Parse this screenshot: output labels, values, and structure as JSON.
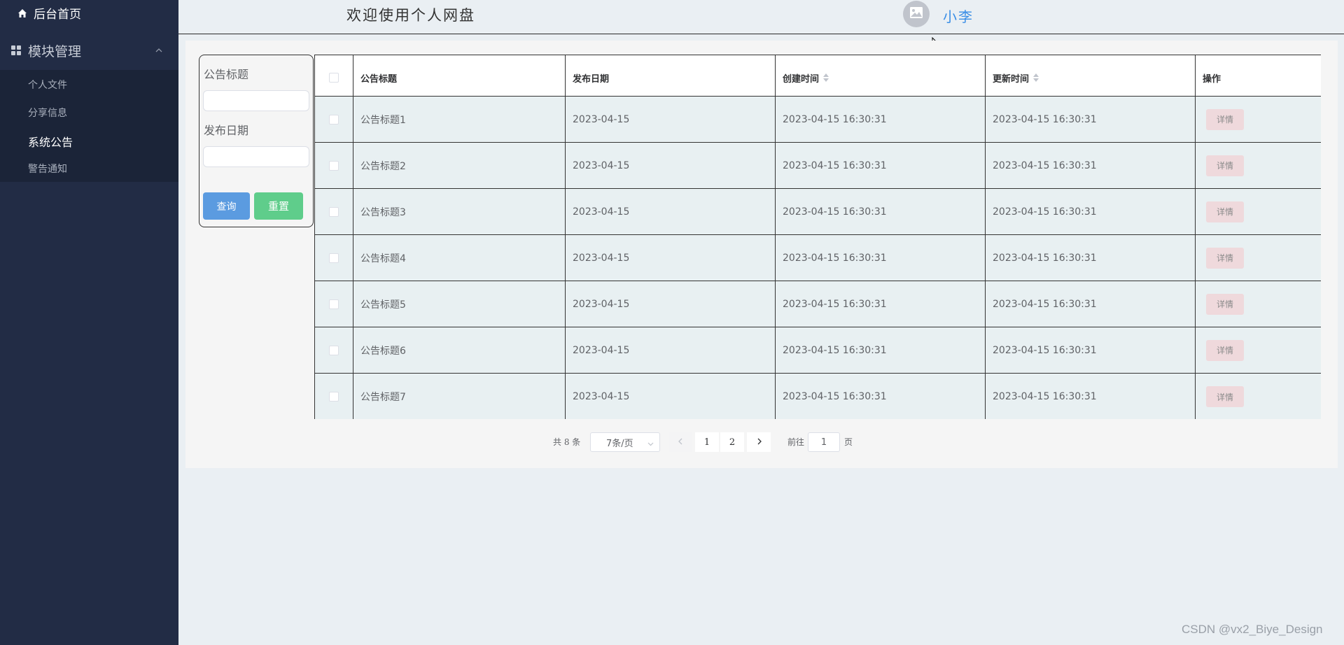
{
  "sidebar": {
    "home_label": "后台首页",
    "group_label": "模块管理",
    "items": [
      {
        "label": "个人文件"
      },
      {
        "label": "分享信息"
      },
      {
        "label": "系统公告",
        "active": true
      },
      {
        "label": "警告通知"
      }
    ]
  },
  "header": {
    "title": "欢迎使用个人网盘",
    "username": "小李"
  },
  "search": {
    "title_label": "公告标题",
    "date_label": "发布日期",
    "query_button": "查询",
    "reset_button": "重置"
  },
  "table": {
    "columns": [
      "公告标题",
      "发布日期",
      "创建时间",
      "更新时间",
      "操作"
    ],
    "rows": [
      {
        "title": "公告标题1",
        "publish_date": "2023-04-15",
        "created": "2023-04-15 16:30:31",
        "updated": "2023-04-15 16:30:31",
        "action": "详情"
      },
      {
        "title": "公告标题2",
        "publish_date": "2023-04-15",
        "created": "2023-04-15 16:30:31",
        "updated": "2023-04-15 16:30:31",
        "action": "详情"
      },
      {
        "title": "公告标题3",
        "publish_date": "2023-04-15",
        "created": "2023-04-15 16:30:31",
        "updated": "2023-04-15 16:30:31",
        "action": "详情"
      },
      {
        "title": "公告标题4",
        "publish_date": "2023-04-15",
        "created": "2023-04-15 16:30:31",
        "updated": "2023-04-15 16:30:31",
        "action": "详情"
      },
      {
        "title": "公告标题5",
        "publish_date": "2023-04-15",
        "created": "2023-04-15 16:30:31",
        "updated": "2023-04-15 16:30:31",
        "action": "详情"
      },
      {
        "title": "公告标题6",
        "publish_date": "2023-04-15",
        "created": "2023-04-15 16:30:31",
        "updated": "2023-04-15 16:30:31",
        "action": "详情"
      },
      {
        "title": "公告标题7",
        "publish_date": "2023-04-15",
        "created": "2023-04-15 16:30:31",
        "updated": "2023-04-15 16:30:31",
        "action": "详情"
      }
    ]
  },
  "pagination": {
    "total": "共 8 条",
    "page_size": "7条/页",
    "pages": [
      "1",
      "2"
    ],
    "goto_label": "前往",
    "goto_value": "1",
    "goto_unit": "页"
  },
  "watermark": "CSDN @vx2_Biye_Design",
  "colors": {
    "sidebar_bg": "#222c45",
    "submenu_bg": "#1b2438",
    "accent_blue": "#3a8ee6",
    "query_btn": "#5b9be0",
    "reset_btn": "#5fcd8b",
    "detail_btn": "#efd9dc",
    "row_bg": "#e8f0f2"
  },
  "icons": {
    "home": "home-icon",
    "module": "grid-icon",
    "collapse": "chevron-up-icon",
    "avatar": "image-icon",
    "sort": "sort-icon",
    "prev": "chevron-left-icon",
    "next": "chevron-right-icon",
    "select": "chevron-down-icon"
  }
}
